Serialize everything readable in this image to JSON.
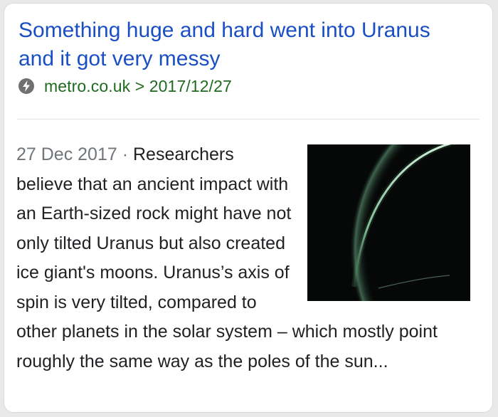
{
  "result": {
    "title": "Something huge and hard went into Uranus and it got very messy",
    "source": "metro.co.uk > 2017/12/27",
    "source_icon": "amp-lightning-icon",
    "date": "27 Dec 2017",
    "separator": " · ",
    "snippet": "Researchers believe that an ancient impact with an Earth-sized rock might have not only tilted Uranus but also created ice giant's moons. Uranus’s axis of spin is very tilted, compared to other planets in the solar system – which mostly point roughly the same way as the poles of the sun...",
    "thumbnail_icon": "uranus-crescent-image"
  },
  "colors": {
    "title_link": "#1a4fc4",
    "source_url": "#1f6b1f",
    "date_gray": "#70757a",
    "body_text": "#202124",
    "planet_rim": "#bfe8c8"
  }
}
